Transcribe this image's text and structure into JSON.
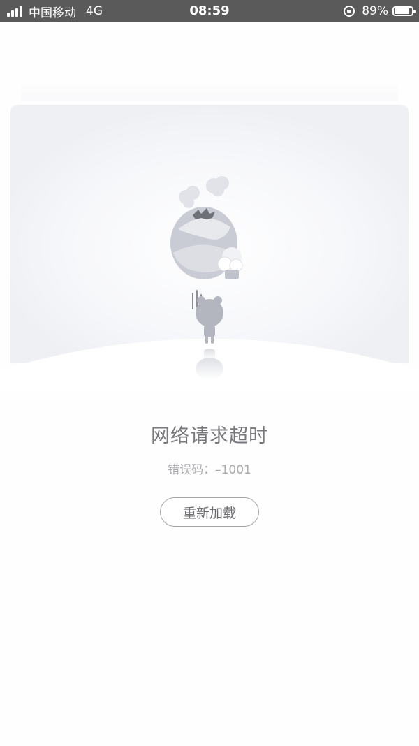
{
  "status_bar": {
    "carrier": "中国移动",
    "network": "4G",
    "time": "08:59",
    "battery_percent": "89%",
    "battery_level": 0.89,
    "signal_icon": "signal-bars-icon",
    "rotation_lock_icon": "rotation-lock-icon",
    "battery_icon": "battery-icon"
  },
  "illustration": {
    "icon": "broken-balloon-illustration"
  },
  "error": {
    "title": "网络请求超时",
    "code_text": "错误码：–1001"
  },
  "actions": {
    "reload_label": "重新加载"
  },
  "colors": {
    "status_bar_bg": "#5a5a5a",
    "title_text": "#77787c",
    "code_text": "#a9aaad",
    "button_border": "#a3a4a8"
  }
}
